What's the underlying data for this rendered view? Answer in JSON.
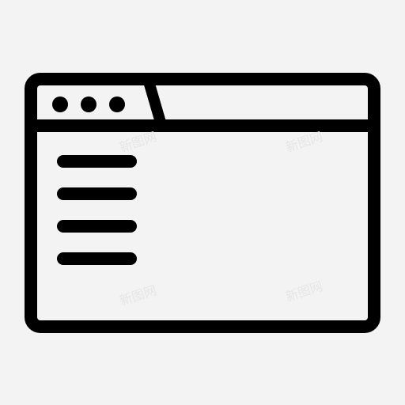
{
  "icon": {
    "name": "browser-window-sidebar-icon",
    "stroke_color": "#000000",
    "background_color": "#f3f3f3"
  },
  "watermark": {
    "text": "新图网",
    "color": "#e6e6e6"
  }
}
